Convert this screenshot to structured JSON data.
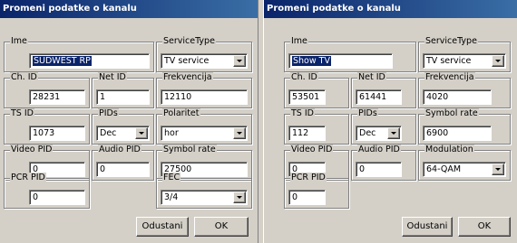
{
  "left": {
    "title": "Promeni podatke o kanalu",
    "fields": {
      "ime": {
        "label": "Ime",
        "value": "SÜDWEST RP"
      },
      "service_type": {
        "label": "ServiceType",
        "value": "TV service"
      },
      "ch_id": {
        "label": "Ch. ID",
        "value": "28231"
      },
      "net_id": {
        "label": "Net ID",
        "value": "1"
      },
      "freq": {
        "label": "Frekvencija",
        "value": "12110"
      },
      "ts_id": {
        "label": "TS ID",
        "value": "1073"
      },
      "pids": {
        "label": "PIDs",
        "value": "Dec"
      },
      "third": {
        "label": "Polaritet",
        "value": "hor"
      },
      "video_pid": {
        "label": "Video PID",
        "value": "0"
      },
      "audio_pid": {
        "label": "Audio PID",
        "value": "0"
      },
      "fourth": {
        "label": "Symbol rate",
        "value": "27500"
      },
      "pcr_pid": {
        "label": "PCR PID",
        "value": "0"
      },
      "fec": {
        "label": "FEC",
        "value": "3/4"
      }
    },
    "buttons": {
      "cancel": "Odustani",
      "ok": "OK"
    }
  },
  "right": {
    "title": "Promeni podatke o kanalu",
    "fields": {
      "ime": {
        "label": "Ime",
        "value": "Show TV"
      },
      "service_type": {
        "label": "ServiceType",
        "value": "TV service"
      },
      "ch_id": {
        "label": "Ch. ID",
        "value": "53501"
      },
      "net_id": {
        "label": "Net ID",
        "value": "61441"
      },
      "freq": {
        "label": "Frekvencija",
        "value": "4020"
      },
      "ts_id": {
        "label": "TS ID",
        "value": "112"
      },
      "pids": {
        "label": "PIDs",
        "value": "Dec"
      },
      "third": {
        "label": "Symbol rate",
        "value": "6900"
      },
      "video_pid": {
        "label": "Video PID",
        "value": "0"
      },
      "audio_pid": {
        "label": "Audio PID",
        "value": "0"
      },
      "fourth": {
        "label": "Modulation",
        "value": "64-QAM"
      },
      "pcr_pid": {
        "label": "PCR PID",
        "value": "0"
      }
    },
    "buttons": {
      "cancel": "Odustani",
      "ok": "OK"
    }
  }
}
